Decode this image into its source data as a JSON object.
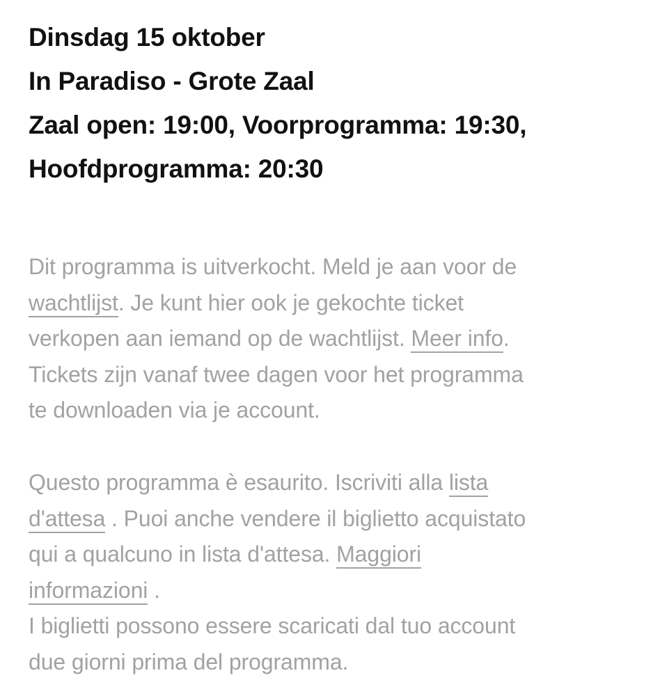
{
  "event": {
    "date": "Dinsdag 15 oktober",
    "venue": "In Paradiso - Grote Zaal",
    "schedule_line1": "Zaal open: 19:00, Voorprogramma: 19:30,",
    "schedule_line2": "Hoofdprogramma: 20:30"
  },
  "notice_nl": {
    "l1": "Dit programma is uitverkocht. Meld je aan voor de",
    "waitlist_link": "wachtlijst",
    "l2_rest": ". Je kunt hier ook je gekochte ticket",
    "l3_pre": "verkopen aan iemand op de wachtlijst. ",
    "more_info_link": "Meer info",
    "l3_post": ".",
    "l4": "Tickets zijn vanaf twee dagen voor het programma",
    "l5": "te downloaden via je account."
  },
  "notice_it": {
    "l1_pre": "Questo programma è esaurito. Iscriviti alla ",
    "waitlist_link_part1": "lista",
    "waitlist_link_part2": "d'attesa",
    "l2_rest": " . Puoi anche vendere il biglietto acquistato",
    "l3_pre": "qui a qualcuno in lista d'attesa. ",
    "more_info_link_part1": "Maggiori",
    "more_info_link_part2": "informazioni",
    "l4_rest": " .",
    "l5": "I biglietti possono essere scaricati dal tuo account",
    "l6": "due giorni prima del programma."
  }
}
